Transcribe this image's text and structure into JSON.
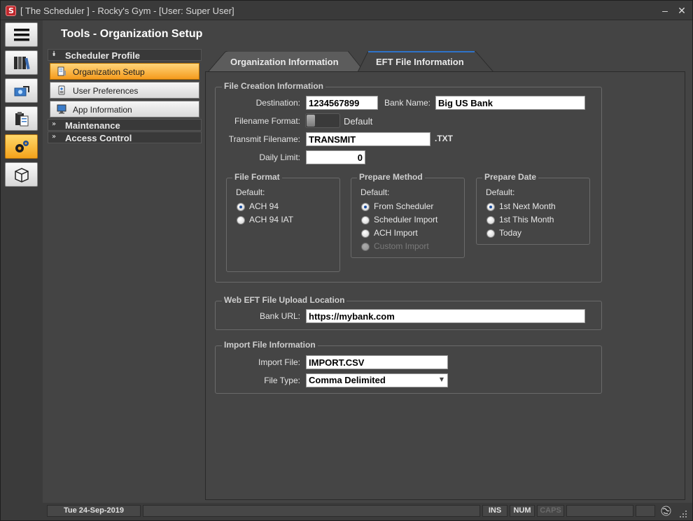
{
  "window": {
    "title": "[ The Scheduler ] - Rocky's Gym - [User: Super User]",
    "minimize_glyph": "–",
    "close_glyph": "✕"
  },
  "rail": {
    "items": [
      {
        "name": "menu-icon"
      },
      {
        "name": "library-icon"
      },
      {
        "name": "payment-icon"
      },
      {
        "name": "clipboard-icon"
      },
      {
        "name": "settings-icon",
        "active": true
      },
      {
        "name": "package-icon"
      }
    ]
  },
  "page": {
    "title": "Tools - Organization Setup"
  },
  "nav": {
    "groups": [
      {
        "label": "Scheduler Profile",
        "expanded": true
      },
      {
        "label": "Maintenance",
        "expanded": false
      },
      {
        "label": "Access Control",
        "expanded": false
      }
    ],
    "items": [
      {
        "label": "Organization Setup",
        "active": true,
        "icon": "building-icon"
      },
      {
        "label": "User Preferences",
        "active": false,
        "icon": "user-prefs-icon"
      },
      {
        "label": "App Information",
        "active": false,
        "icon": "monitor-icon"
      }
    ]
  },
  "tabs": [
    {
      "label": "Organization Information",
      "active": false
    },
    {
      "label": "EFT File Information",
      "active": true
    }
  ],
  "file_creation": {
    "title": "File Creation Information",
    "destination_label": "Destination:",
    "destination_value": "1234567899",
    "bank_name_label": "Bank Name:",
    "bank_name_value": "Big US Bank",
    "filename_format_label": "Filename Format:",
    "filename_format_value": "Default",
    "transmit_label": "Transmit Filename:",
    "transmit_value": "TRANSMIT",
    "transmit_ext": ".TXT",
    "daily_limit_label": "Daily Limit:",
    "daily_limit_value": "0",
    "file_format": {
      "title": "File Format",
      "default_label": "Default:",
      "options": [
        {
          "label": "ACH 94",
          "checked": true
        },
        {
          "label": "ACH 94 IAT",
          "checked": false
        }
      ]
    },
    "prepare_method": {
      "title": "Prepare Method",
      "default_label": "Default:",
      "options": [
        {
          "label": "From Scheduler",
          "checked": true
        },
        {
          "label": "Scheduler Import",
          "checked": false
        },
        {
          "label": "ACH Import",
          "checked": false
        },
        {
          "label": "Custom Import",
          "checked": false,
          "disabled": true
        }
      ]
    },
    "prepare_date": {
      "title": "Prepare Date",
      "default_label": "Default:",
      "options": [
        {
          "label": "1st Next Month",
          "checked": true
        },
        {
          "label": "1st This Month",
          "checked": false
        },
        {
          "label": "Today",
          "checked": false
        }
      ]
    }
  },
  "web_eft": {
    "title": "Web EFT File Upload Location",
    "bank_url_label": "Bank URL:",
    "bank_url_value": "https://mybank.com"
  },
  "import_file": {
    "title": "Import File Information",
    "import_file_label": "Import File:",
    "import_file_value": "IMPORT.CSV",
    "file_type_label": "File Type:",
    "file_type_value": "Comma Delimited"
  },
  "status": {
    "date": "Tue  24-Sep-2019",
    "ins": "INS",
    "num": "NUM",
    "caps": "CAPS"
  },
  "colors": {
    "accent": "#f5a623",
    "tab_active": "#454545",
    "tab_inactive": "#5a5a5a"
  }
}
